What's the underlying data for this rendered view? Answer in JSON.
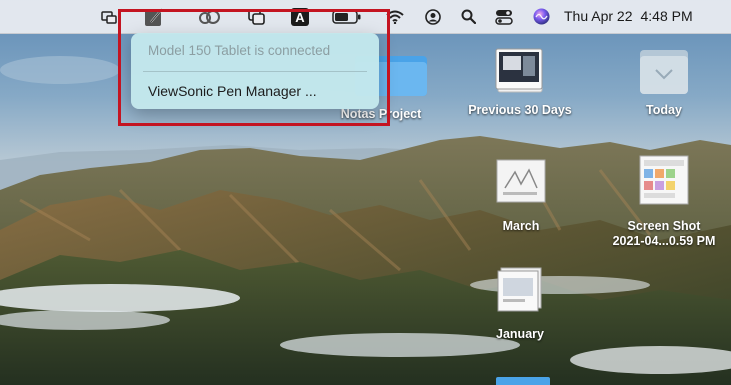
{
  "menubar": {
    "icons": [
      "screen-mirror-icon",
      "pen-tablet-icon",
      "creative-cloud-icon",
      "window-switch-icon",
      "input-source-icon",
      "battery-icon",
      "wifi-icon",
      "user-account-icon",
      "search-icon",
      "control-center-icon",
      "siri-icon"
    ],
    "input_source_label": "A",
    "clock": {
      "day": "Thu Apr 22",
      "time": "4:48 PM"
    }
  },
  "dropdown": {
    "status": "Model 150 Tablet is connected",
    "items": [
      "ViewSonic Pen Manager ..."
    ]
  },
  "desktop": {
    "items": [
      {
        "label": "Notas Project"
      },
      {
        "label": "Previous 30 Days"
      },
      {
        "label": "Today"
      },
      {
        "label": "March"
      },
      {
        "label": "Screen Shot",
        "label2": "2021-04...0.59 PM"
      },
      {
        "label": "January"
      }
    ]
  },
  "colors": {
    "highlight": "#c41421",
    "dropdown_bg": "#c4e8ec",
    "folder_blue": "#4aa3e8"
  }
}
